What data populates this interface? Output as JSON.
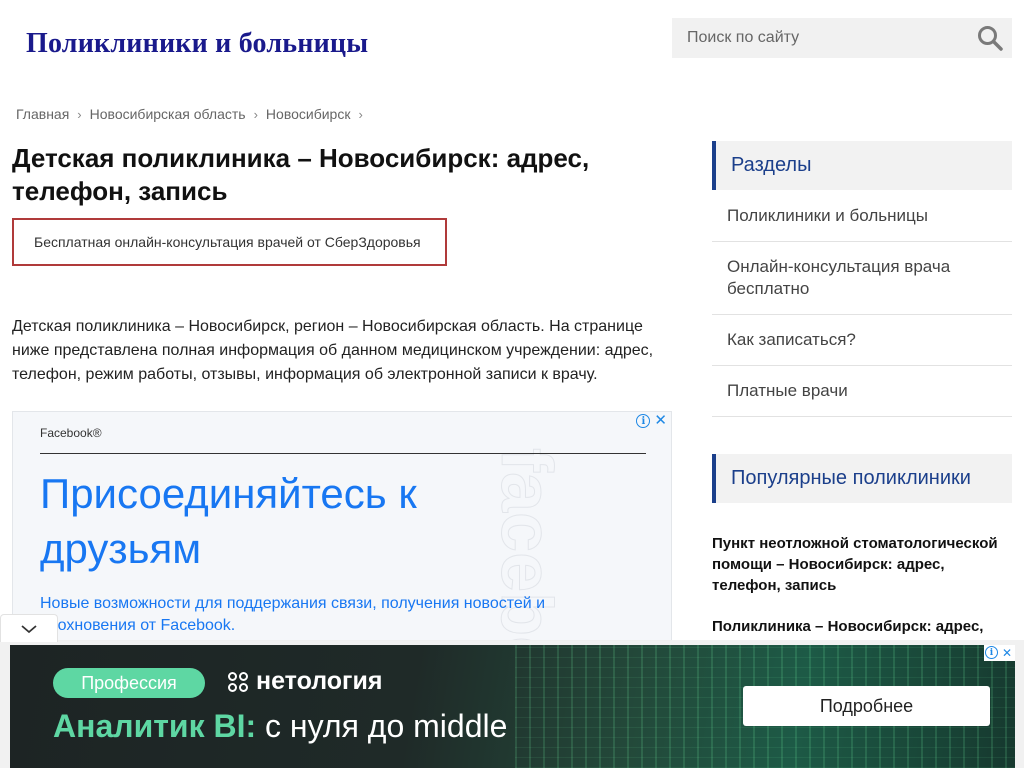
{
  "site": {
    "logo": "Поликлиники и больницы",
    "search_placeholder": "Поиск по сайту"
  },
  "breadcrumb": {
    "items": [
      "Главная",
      "Новосибирская область",
      "Новосибирск"
    ],
    "separator": "›"
  },
  "main": {
    "title": "Детская поликлиника – Новосибирск: адрес, телефон, запись",
    "consult_button": "Бесплатная онлайн-консультация врачей от СберЗдоровья",
    "intro": "Детская поликлиника – Новосибирск, регион – Новосибирская область. На странице ниже представлена полная информация об данном медицинском учреждении: адрес, телефон, режим работы, отзывы, информация об электронной записи к врачу."
  },
  "ad": {
    "brand": "Facebook®",
    "headline": "Присоединяйтесь к друзьям",
    "description": "Новые возможности для поддержания связи, получения новостей и вдохновения от Facebook.",
    "watermark": "facebook",
    "info_glyph": "i",
    "close_glyph": "✕"
  },
  "sidebar": {
    "sections_heading": "Разделы",
    "sections": [
      "Поликлиники и больницы",
      "Онлайн-консультация врача бесплатно",
      "Как записаться?",
      "Платные врачи"
    ],
    "popular_heading": "Популярные поликлиники",
    "popular": [
      "Пункт неотложной стоматологической помощи – Новосибирск: адрес, телефон, запись",
      "Поликлиника – Новосибирск: адрес,"
    ]
  },
  "banner": {
    "pill": "Профессия",
    "logo": "нетология",
    "headline_accent": "Аналитик BI:",
    "headline_rest": "с нуля до middle",
    "cta": "Подробнее",
    "info_glyph": "i",
    "close_glyph": "✕"
  },
  "colors": {
    "logo": "#1a1a8c",
    "accent_blue": "#1b3f8b",
    "facebook_blue": "#1877f2",
    "consult_border": "#b03a3a",
    "banner_green": "#5ed7a3"
  },
  "icons": {
    "search": "search-icon",
    "collapse": "chevron-down-icon"
  }
}
